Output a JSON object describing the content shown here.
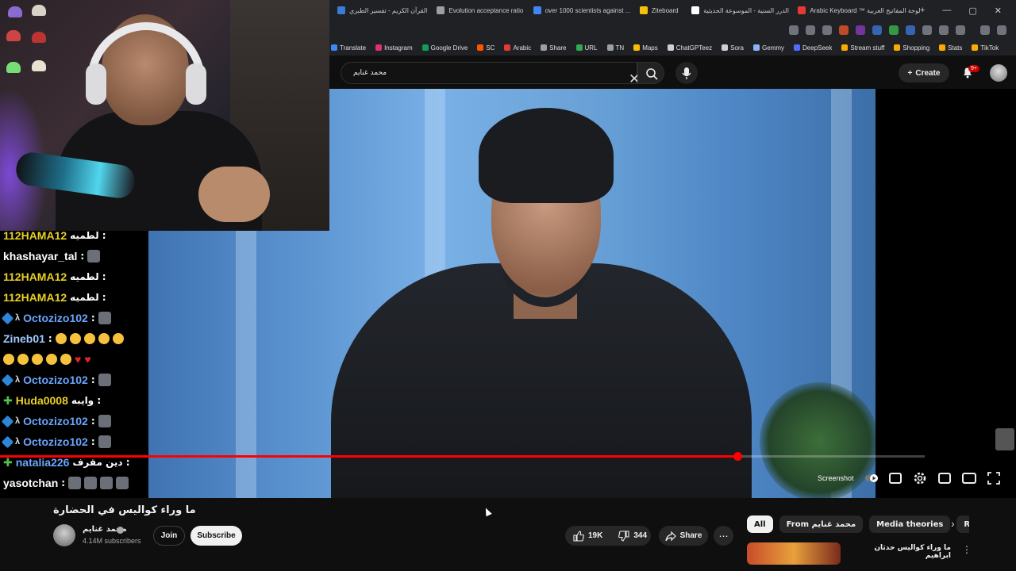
{
  "browser": {
    "tabs": [
      {
        "label": "القرآن الكريم - تفسير الطبري",
        "color": "#3a7bd5"
      },
      {
        "label": "Evolution acceptance ratio",
        "color": "#9aa0a6"
      },
      {
        "label": "over 1000 scientists against ...",
        "color": "#4285f4"
      },
      {
        "label": "Ziteboard",
        "color": "#f4c20d"
      },
      {
        "label": "الدرر السنية - الموسوعة الحديثية",
        "color": "#ffffff"
      },
      {
        "label": "Arabic Keyboard ™ لوحة المفاتيح العربية",
        "color": "#e53935"
      }
    ],
    "window_controls": [
      "+",
      "—",
      "▢",
      "✕"
    ],
    "bookmarks": [
      {
        "label": "Translate",
        "color": "#4285f4"
      },
      {
        "label": "Instagram",
        "color": "#e1306c"
      },
      {
        "label": "Google Drive",
        "color": "#0f9d58"
      },
      {
        "label": "SC",
        "color": "#ff5500"
      },
      {
        "label": "Arabic",
        "color": "#e53935"
      },
      {
        "label": "Share",
        "color": "#9aa0a6"
      },
      {
        "label": "URL",
        "color": "#34a853"
      },
      {
        "label": "TN",
        "color": "#9aa0a6"
      },
      {
        "label": "Maps",
        "color": "#fbbc05"
      },
      {
        "label": "ChatGPTeez",
        "color": "#d0d0d0"
      },
      {
        "label": "Sora",
        "color": "#d0d0d0"
      },
      {
        "label": "Gemmy",
        "color": "#8ab4f8"
      },
      {
        "label": "DeepSeek",
        "color": "#4d6bfe"
      },
      {
        "label": "Stream stuff",
        "color": "#f9ab00"
      },
      {
        "label": "Shopping",
        "color": "#f9ab00"
      },
      {
        "label": "Stats",
        "color": "#f9ab00"
      },
      {
        "label": "TikTok",
        "color": "#f9ab00"
      }
    ]
  },
  "header": {
    "search_value": "محمد غنايم",
    "create_label": "Create",
    "notifications_badge": "9+"
  },
  "chat": {
    "messages": [
      {
        "user": "112HAMA12",
        "user_color": "#e8d024",
        "badge": "",
        "message": ": لطميه",
        "emoji": ""
      },
      {
        "user": "khashayar_tal",
        "user_color": "#ffffff",
        "badge": "",
        "message": ":",
        "emoji": "image"
      },
      {
        "user": "112HAMA12",
        "user_color": "#e8d024",
        "badge": "",
        "message": ": لطميه",
        "emoji": ""
      },
      {
        "user": "112HAMA12",
        "user_color": "#e8d024",
        "badge": "",
        "message": ": لطميه",
        "emoji": ""
      },
      {
        "user": "Octozizo102",
        "user_color": "#6aa6ff",
        "badge": "cube",
        "message": ":",
        "emoji": "image"
      },
      {
        "user": "Zineb01",
        "user_color": "#9ecbff",
        "badge": "",
        "message": ":",
        "emoji": "laugh"
      },
      {
        "user": "",
        "user_color": "#ffffff",
        "badge": "",
        "message": "",
        "emoji": "laugh-hearts"
      },
      {
        "user": "Octozizo102",
        "user_color": "#6aa6ff",
        "badge": "cube",
        "message": ":",
        "emoji": "image"
      },
      {
        "user": "Huda0008",
        "user_color": "#e8d024",
        "badge": "plus",
        "message": ": وايبه",
        "emoji": ""
      },
      {
        "user": "Octozizo102",
        "user_color": "#6aa6ff",
        "badge": "cube",
        "message": ":",
        "emoji": "image"
      },
      {
        "user": "Octozizo102",
        "user_color": "#6aa6ff",
        "badge": "cube",
        "message": ":",
        "emoji": "image"
      },
      {
        "user": "natalia226",
        "user_color": "#6aa6ff",
        "badge": "plus",
        "message": ": دين مقرف",
        "emoji": ""
      },
      {
        "user": "yasotchan",
        "user_color": "#ffffff",
        "badge": "",
        "message": ":",
        "emoji": "images"
      }
    ]
  },
  "player": {
    "progress_fraction": 0.797,
    "buffered_fraction": 1.0,
    "screenshot_label": "Screenshot"
  },
  "video": {
    "title": "ما وراء كواليس في الحضارة",
    "channel_name": "محمد غنايم",
    "subscribers": "4.14M subscribers",
    "join_label": "Join",
    "subscribe_label": "Subscribe",
    "likes": "19K",
    "dislikes": "344",
    "share_label": "Share"
  },
  "sidebar": {
    "chips": [
      "All",
      "From محمد غنايم",
      "Media theories",
      "Related"
    ],
    "recommendation_title": "ما وراء كواليس حدثان ابراهيم"
  }
}
